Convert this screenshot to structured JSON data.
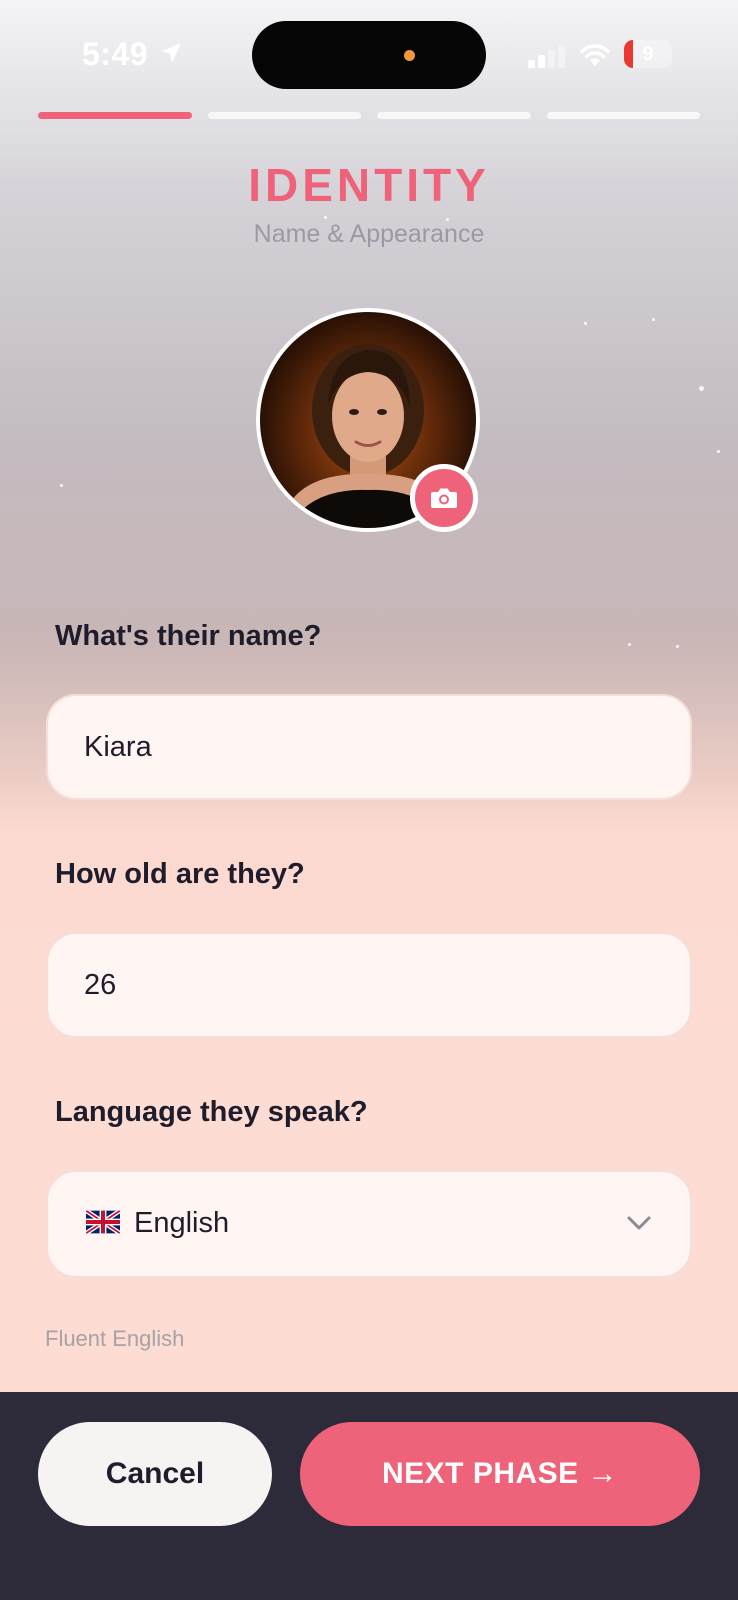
{
  "status_bar": {
    "time": "5:49",
    "battery_level": "9",
    "battery_fraction": 0.09,
    "location_icon": "location-arrow-icon",
    "wifi_icon": "wifi-icon",
    "signal_icon": "cellular-signal-icon"
  },
  "progress": {
    "total_steps": 4,
    "current_step": 1
  },
  "header": {
    "title": "IDENTITY",
    "subtitle": "Name & Appearance"
  },
  "avatar": {
    "camera_icon": "camera-icon"
  },
  "form": {
    "name": {
      "label": "What's their name?",
      "value": "Kiara"
    },
    "age": {
      "label": "How old are they?",
      "value": "26"
    },
    "language": {
      "label": "Language they speak?",
      "selected": "English",
      "flag_icon": "uk-flag-icon",
      "chevron_icon": "chevron-down-icon",
      "helper": "Fluent English"
    }
  },
  "footer": {
    "cancel_label": "Cancel",
    "next_label": "NEXT PHASE →"
  },
  "colors": {
    "accent": "#ee6379",
    "text_dark": "#1f1c2c",
    "field_bg": "#fff5f2",
    "bottom_bar": "#2d2b3a"
  }
}
